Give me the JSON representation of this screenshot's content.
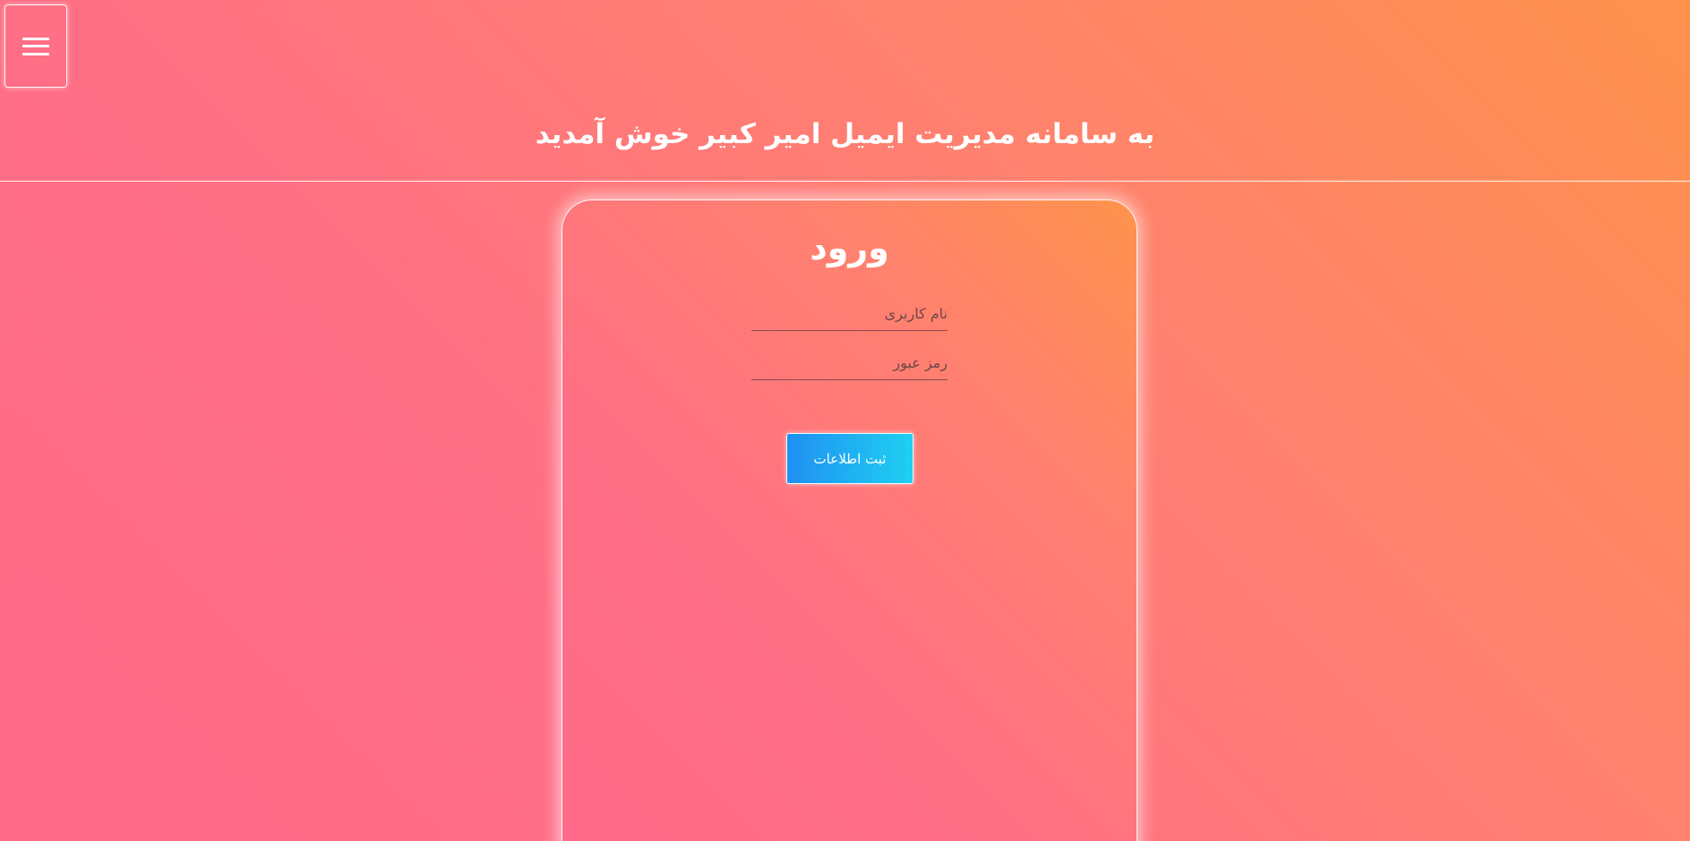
{
  "header": {
    "menu_icon": "hamburger-menu-icon",
    "title": "به سامانه مدیریت ایمیل امیر کبیر خوش آمدید"
  },
  "login": {
    "title": "ورود",
    "username_placeholder": "نام کاربری",
    "password_placeholder": "رمز عبور",
    "submit_label": "ثبت اطلاعات"
  },
  "colors": {
    "background_from": "#ff6a8a",
    "background_to": "#ff934c",
    "button_from": "#1f90f2",
    "button_to": "#1fd0f2",
    "text": "#ffffff"
  }
}
